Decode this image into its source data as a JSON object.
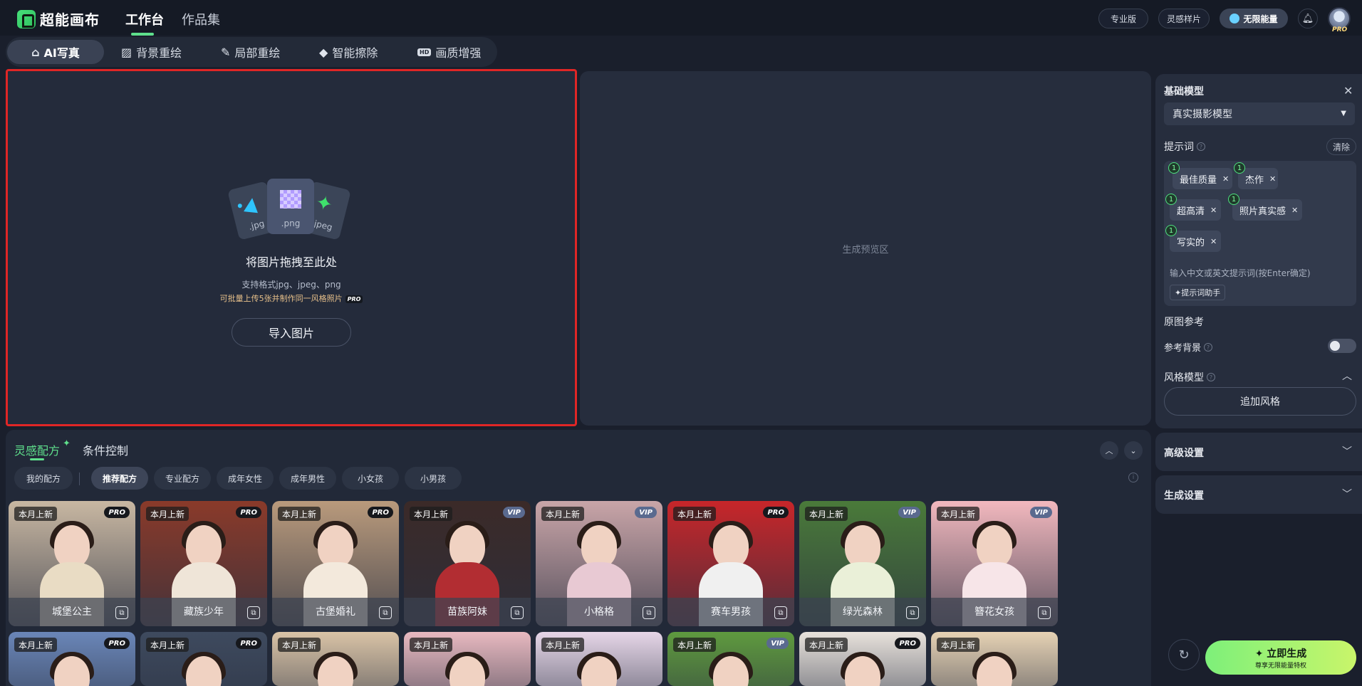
{
  "header": {
    "logo_text": "超能画布",
    "tabs": [
      "工作台",
      "作品集"
    ],
    "pro_version": "专业版",
    "inspiration": "灵感样片",
    "energy": "无限能量",
    "avatar_badge": "PRO"
  },
  "tools": [
    "AI写真",
    "背景重绘",
    "局部重绘",
    "智能擦除",
    "画质增强"
  ],
  "upload": {
    "file_labels": [
      ".jpg",
      ".png",
      ".jpeg"
    ],
    "title": "将图片拖拽至此处",
    "formats": "支持格式jpg、jpeg、png",
    "batch": "可批量上传5张并制作同一风格照片",
    "batch_badge": "PRO",
    "button": "导入图片"
  },
  "preview": {
    "placeholder": "生成预览区"
  },
  "settings": {
    "base_model_label": "基础模型",
    "base_model_value": "真实摄影模型",
    "prompt_label": "提示词",
    "clear": "清除",
    "chips": [
      {
        "text": "最佳质量",
        "weight": "1"
      },
      {
        "text": "杰作",
        "weight": "1"
      },
      {
        "text": "超高清",
        "weight": "1"
      },
      {
        "text": "照片真实感",
        "weight": "1"
      },
      {
        "text": "写实的",
        "weight": "1"
      }
    ],
    "prompt_placeholder": "输入中文或英文提示词(按Enter确定)",
    "prompt_assistant": "✦提示词助手",
    "ref_label": "原图参考",
    "ref_bg_label": "参考背景",
    "ref_bg_on": false,
    "style_label": "风格模型",
    "add_style": "追加风格",
    "advanced": "高级设置",
    "generation": "生成设置"
  },
  "recipe": {
    "tab_active": "灵感配方",
    "tab_inactive": "条件控制",
    "filters": [
      "我的配方",
      "推荐配方",
      "专业配方",
      "成年女性",
      "成年男性",
      "小女孩",
      "小男孩"
    ],
    "selected_filter": "推荐配方",
    "new_label": "本月上新",
    "cards": [
      {
        "name": "城堡公主",
        "badge": "PRO",
        "bg": "#c8b7a2",
        "cloth": "#e9dcc4"
      },
      {
        "name": "藏族少年",
        "badge": "PRO",
        "bg": "#8a3a2a",
        "cloth": "#efe5d8"
      },
      {
        "name": "古堡婚礼",
        "badge": "PRO",
        "bg": "#b99a7c",
        "cloth": "#f3e9dc"
      },
      {
        "name": "苗族阿妹",
        "badge": "VIP",
        "bg": "#3b2a28",
        "cloth": "#b22d32"
      },
      {
        "name": "小格格",
        "badge": "VIP",
        "bg": "#c9a5a8",
        "cloth": "#e8c9d3"
      },
      {
        "name": "赛车男孩",
        "badge": "PRO",
        "bg": "#c7262a",
        "cloth": "#f0f0f0"
      },
      {
        "name": "绿光森林",
        "badge": "VIP",
        "bg": "#4a7a3a",
        "cloth": "#eaf0d8"
      },
      {
        "name": "簪花女孩",
        "badge": "VIP",
        "bg": "#f2b8be",
        "cloth": "#f7e5e8"
      }
    ],
    "second_row": [
      {
        "badge": "PRO",
        "bg": "#6a86b8"
      },
      {
        "badge": "PRO",
        "bg": "#3e4a5e"
      },
      {
        "badge": "",
        "bg": "#d9c3a6"
      },
      {
        "badge": "",
        "bg": "#e8b9c0"
      },
      {
        "badge": "",
        "bg": "#e6d6e8"
      },
      {
        "badge": "VIP",
        "bg": "#5f9a3f"
      },
      {
        "badge": "PRO",
        "bg": "#e8e2dc"
      },
      {
        "badge": "",
        "bg": "#e6d2b4"
      }
    ]
  },
  "generate": {
    "main": "✦ 立即生成",
    "sub": "尊享无限能量特权"
  }
}
